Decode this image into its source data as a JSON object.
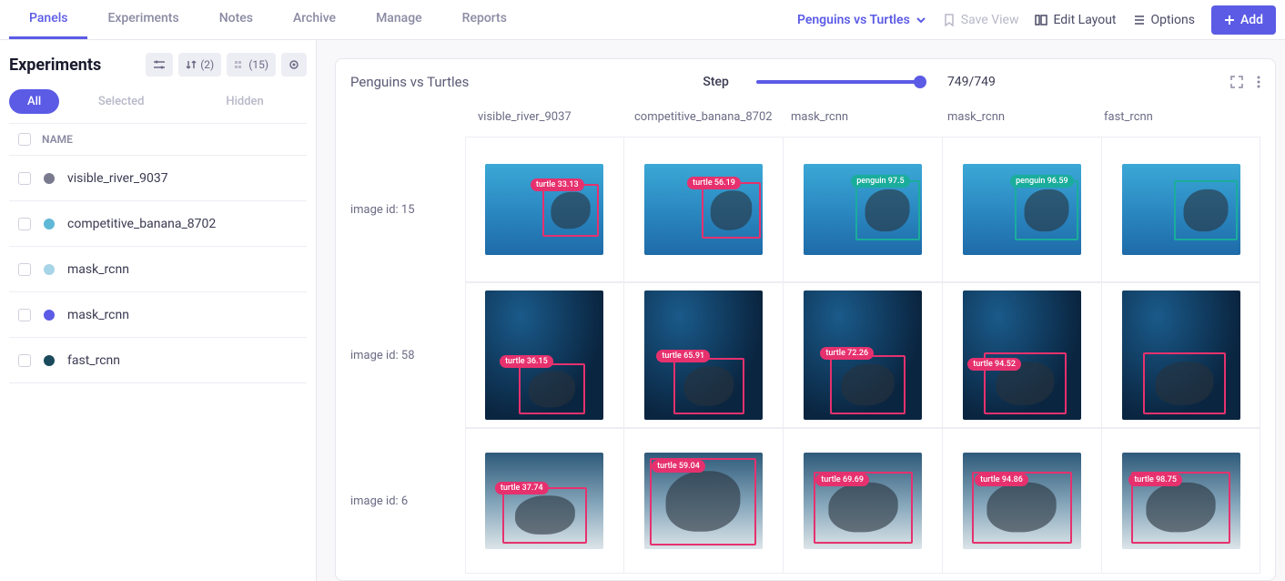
{
  "topbar": {
    "tabs": [
      "Panels",
      "Experiments",
      "Notes",
      "Archive",
      "Manage",
      "Reports"
    ],
    "project": "Penguins vs Turtles",
    "save_view": "Save View",
    "edit_layout": "Edit Layout",
    "options": "Options",
    "add": "Add"
  },
  "sidebar": {
    "title": "Experiments",
    "chip_sort_count": "(2)",
    "chip_cols_count": "(15)",
    "filter": {
      "all": "All",
      "selected": "Selected",
      "hidden": "Hidden"
    },
    "col_name": "NAME",
    "experiments": [
      {
        "name": "visible_river_9037",
        "color": "#7a7a8f"
      },
      {
        "name": "competitive_banana_8702",
        "color": "#5fb8d6"
      },
      {
        "name": "mask_rcnn",
        "color": "#a8d4e8"
      },
      {
        "name": "mask_rcnn",
        "color": "#5b5be6"
      },
      {
        "name": "fast_rcnn",
        "color": "#1a4a5c"
      }
    ]
  },
  "panel": {
    "title": "Penguins vs Turtles",
    "step_label": "Step",
    "step_value": "749/749",
    "columns": [
      "visible_river_9037",
      "competitive_banana_8702",
      "mask_rcnn",
      "mask_rcnn",
      "fast_rcnn"
    ],
    "rows": [
      {
        "label": "image id: 15",
        "cells": [
          {
            "tag": "turtle 33.13",
            "cls": "pink",
            "box": "b-pink",
            "bx": "48%",
            "by": "22%",
            "bw": "48%",
            "bh": "58%",
            "lx": "38%",
            "ly": "16%"
          },
          {
            "tag": "turtle 56.19",
            "cls": "pink",
            "box": "b-pink",
            "bx": "48%",
            "by": "20%",
            "bw": "50%",
            "bh": "62%",
            "lx": "36%",
            "ly": "14%"
          },
          {
            "tag": "penguin 97.5",
            "cls": "teal",
            "box": "b-teal",
            "bx": "44%",
            "by": "18%",
            "bw": "54%",
            "bh": "66%",
            "lx": "40%",
            "ly": "12%"
          },
          {
            "tag": "penguin 96.59",
            "cls": "teal",
            "box": "b-teal",
            "bx": "44%",
            "by": "18%",
            "bw": "54%",
            "bh": "66%",
            "lx": "40%",
            "ly": "12%"
          },
          {
            "tag": "",
            "cls": "teal",
            "box": "b-teal",
            "bx": "44%",
            "by": "18%",
            "bw": "54%",
            "bh": "66%",
            "lx": "40%",
            "ly": "12%"
          }
        ]
      },
      {
        "label": "image id: 58",
        "cells": [
          {
            "tag": "turtle 36.15",
            "cls": "pink",
            "box": "b-pink",
            "bx": "28%",
            "by": "56%",
            "bw": "56%",
            "bh": "40%",
            "lx": "12%",
            "ly": "50%"
          },
          {
            "tag": "turtle 65.91",
            "cls": "pink",
            "box": "b-pink",
            "bx": "24%",
            "by": "52%",
            "bw": "60%",
            "bh": "44%",
            "lx": "10%",
            "ly": "46%"
          },
          {
            "tag": "turtle 72.26",
            "cls": "pink",
            "box": "b-pink",
            "bx": "22%",
            "by": "50%",
            "bw": "64%",
            "bh": "46%",
            "lx": "14%",
            "ly": "44%"
          },
          {
            "tag": "turtle 94.52",
            "cls": "pink",
            "box": "b-pink",
            "bx": "18%",
            "by": "48%",
            "bw": "70%",
            "bh": "48%",
            "lx": "4%",
            "ly": "52%"
          },
          {
            "tag": "",
            "cls": "pink",
            "box": "b-pink",
            "bx": "18%",
            "by": "48%",
            "bw": "70%",
            "bh": "48%",
            "lx": "4%",
            "ly": "52%"
          }
        ]
      },
      {
        "label": "image id: 6",
        "cells": [
          {
            "tag": "turtle 37.74",
            "cls": "pink",
            "box": "b-pink",
            "bx": "14%",
            "by": "36%",
            "bw": "72%",
            "bh": "58%",
            "lx": "8%",
            "ly": "30%"
          },
          {
            "tag": "turtle 59.04",
            "cls": "pink",
            "box": "b-pink",
            "bx": "4%",
            "by": "6%",
            "bw": "90%",
            "bh": "90%",
            "lx": "6%",
            "ly": "8%"
          },
          {
            "tag": "turtle 69.69",
            "cls": "pink",
            "box": "b-pink",
            "bx": "8%",
            "by": "20%",
            "bw": "84%",
            "bh": "74%",
            "lx": "10%",
            "ly": "22%"
          },
          {
            "tag": "turtle 94.86",
            "cls": "pink",
            "box": "b-pink",
            "bx": "8%",
            "by": "20%",
            "bw": "84%",
            "bh": "74%",
            "lx": "10%",
            "ly": "22%"
          },
          {
            "tag": "turtle 98.75",
            "cls": "pink",
            "box": "b-pink",
            "bx": "8%",
            "by": "20%",
            "bw": "84%",
            "bh": "74%",
            "lx": "6%",
            "ly": "22%"
          }
        ]
      }
    ]
  }
}
